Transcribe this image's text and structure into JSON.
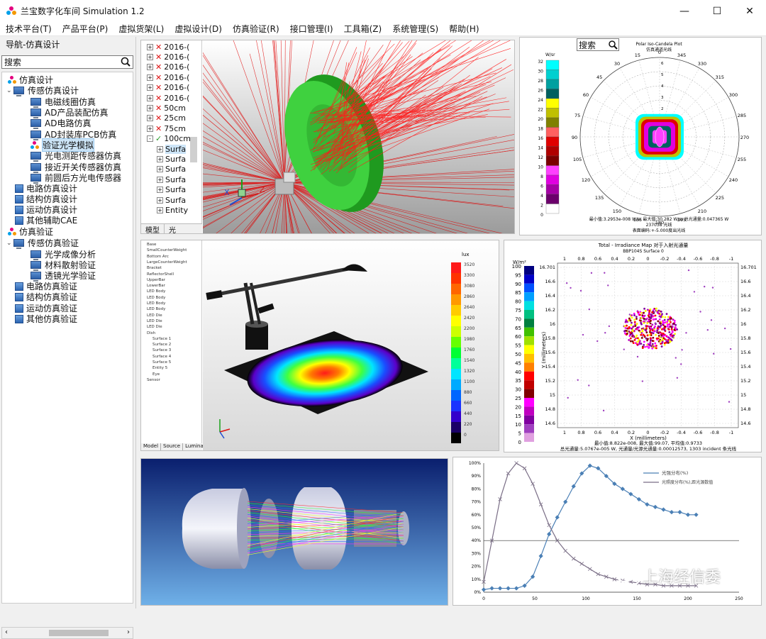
{
  "window": {
    "title": "兰宝数字化车间 Simulation 1.2",
    "minimize": "—",
    "maximize": "☐",
    "close": "✕"
  },
  "menu": [
    "技术平台(T)",
    "产品平台(P)",
    "虚拟货架(L)",
    "虚拟设计(D)",
    "仿真验证(R)",
    "接口管理(I)",
    "工具箱(Z)",
    "系统管理(S)",
    "帮助(H)"
  ],
  "nav": {
    "title": "导航-仿真设计",
    "search_label": "搜索",
    "tree": {
      "design_root": "仿真设计",
      "sensor_design": "传感仿真设计",
      "sensor_design_items": [
        "电磁线圈仿真",
        "AD产品装配仿真",
        "AD电路仿真",
        "AD封装库PCB仿真",
        "验证光学模拟",
        "光电测距传感器仿真",
        "接近开关传感器仿真",
        "前圆后方光电传感器"
      ],
      "other_design": [
        "电路仿真设计",
        "结构仿真设计",
        "运动仿真设计",
        "其他辅助CAE"
      ],
      "verify_root": "仿真验证",
      "sensor_verify": "传感仿真验证",
      "sensor_verify_items": [
        "光学成像分析",
        "材料散射验证",
        "透镜光学验证"
      ],
      "other_verify": [
        "电路仿真验证",
        "结构仿真验证",
        "运动仿真验证",
        "其他仿真验证"
      ]
    }
  },
  "panel1": {
    "tree_items": [
      "2016-(",
      "2016-(",
      "2016-(",
      "2016-(",
      "2016-(",
      "2016-(",
      "50cm",
      "25cm",
      "75cm",
      "100cm",
      "Surfa",
      "Surfa",
      "Surfa",
      "Surfa",
      "Surfa",
      "Surfa",
      "Entity"
    ],
    "tabs": [
      "模型",
      "光"
    ]
  },
  "panel2": {
    "search_label": "搜索",
    "title": "Polar Iso-Candela Plot",
    "subtitle": "仿真通道光线",
    "unit": "W/sr",
    "scale_labels": [
      "32",
      "30",
      "28",
      "26",
      "24",
      "22",
      "20",
      "18",
      "16",
      "14",
      "12",
      "10",
      "8",
      "6",
      "4",
      "2",
      "0"
    ],
    "angle_labels": [
      "0",
      "15",
      "30",
      "45",
      "60",
      "75",
      "90",
      "105",
      "120",
      "135",
      "150",
      "165",
      "180",
      "195",
      "210",
      "225",
      "240",
      "255",
      "270",
      "285",
      "300",
      "315",
      "330",
      "345"
    ],
    "footer1": "最小值:3.2953e-008 W/sr 最大值:30.282 W/sr 总光通量:0.047365 W",
    "footer2": "237038 光线",
    "footer3": "表面编码:+-5.000度出光线",
    "colors": [
      "#ffffff",
      "#6b006b",
      "#a500a5",
      "#e000e0",
      "#ff40ff",
      "#7a0000",
      "#b00000",
      "#e00000",
      "#ff6060",
      "#808000",
      "#c0c000",
      "#ffff00",
      "#006060",
      "#00a0a0",
      "#00d0d0",
      "#00ffff"
    ]
  },
  "panel3": {
    "unit": "lux",
    "scale_labels": [
      "3520",
      "3300",
      "3080",
      "2860",
      "2640",
      "2420",
      "2200",
      "1980",
      "1760",
      "1540",
      "1320",
      "1100",
      "880",
      "660",
      "440",
      "220",
      "0"
    ],
    "tree_items": [
      "Base",
      "SmallCounterWeight",
      "Bottom Arc",
      "LargeCounterWeight",
      "Bracket",
      "ReflectorShell",
      "UpperBar",
      "LowerBar",
      "LED Body",
      "LED Body",
      "LED Body",
      "LED Body",
      "LED Die",
      "LED Die",
      "LED Die",
      "Dish",
      "Surface 1",
      "Surface 2",
      "Surface 3",
      "Surface 4",
      "Surface 5",
      "Entity 5",
      "Eye",
      "Sensor"
    ],
    "tabs": [
      "Model",
      "Source",
      "Luminance"
    ]
  },
  "panel4": {
    "title": "Total - Irradiance Map 对于入射光通量",
    "subtitle": "BBP104S Surface 0",
    "unit": "W/m²",
    "ylabel": "Y (millimeters)",
    "xlabel": "X (millimeters)",
    "scale_labels": [
      "100",
      "95",
      "90",
      "85",
      "80",
      "75",
      "70",
      "65",
      "60",
      "55",
      "50",
      "45",
      "40",
      "35",
      "30",
      "25",
      "20",
      "15",
      "10",
      "5",
      "0"
    ],
    "x_ticks": [
      "1",
      "0.8",
      "0.6",
      "0.4",
      "0.2",
      "0",
      "-0.2",
      "-0.4",
      "-0.6",
      "-0.8",
      "-1"
    ],
    "y_ticks": [
      "16.701",
      "16.6",
      "16.4",
      "16.2",
      "16",
      "15.8",
      "15.6",
      "15.4",
      "15.2",
      "15",
      "14.8",
      "14.6"
    ],
    "footer1": "最小值:8.822e-008, 最大值:99.07, 平均值:0.9733",
    "footer2": "总光通量:5.0767e-005 W, 光通量/光源光通量:0.00012573, 1303 incident 条光线"
  },
  "panel6": {
    "legend": [
      "光强分布(%)",
      "光照度分布(%),距光源数值"
    ],
    "y_ticks": [
      "100%",
      "90%",
      "80%",
      "70%",
      "60%",
      "50%",
      "40%",
      "30%",
      "20%",
      "10%",
      "0%"
    ],
    "x_ticks": [
      "0",
      "50",
      "100",
      "150",
      "200",
      "250"
    ]
  },
  "chart_data": {
    "type": "line",
    "x": [
      0,
      8,
      16,
      24,
      32,
      40,
      48,
      56,
      64,
      72,
      80,
      88,
      96,
      104,
      112,
      120,
      128,
      136,
      144,
      152,
      160,
      168,
      176,
      184,
      192,
      200,
      208
    ],
    "series": [
      {
        "name": "光强分布(%)",
        "values": [
          2,
          3,
          3,
          3,
          3,
          5,
          12,
          28,
          45,
          58,
          70,
          82,
          92,
          98,
          96,
          90,
          84,
          80,
          76,
          72,
          68,
          66,
          64,
          62,
          62,
          60,
          60
        ]
      },
      {
        "name": "光照度分布(%),距光源数值",
        "values": [
          8,
          40,
          72,
          92,
          100,
          96,
          84,
          68,
          52,
          40,
          32,
          26,
          22,
          18,
          14,
          12,
          10,
          9,
          8,
          7,
          6,
          6,
          5,
          5,
          5,
          5,
          5
        ]
      }
    ],
    "xlim": [
      0,
      250
    ],
    "ylim": [
      0,
      100
    ]
  },
  "watermark": "上海经信委"
}
